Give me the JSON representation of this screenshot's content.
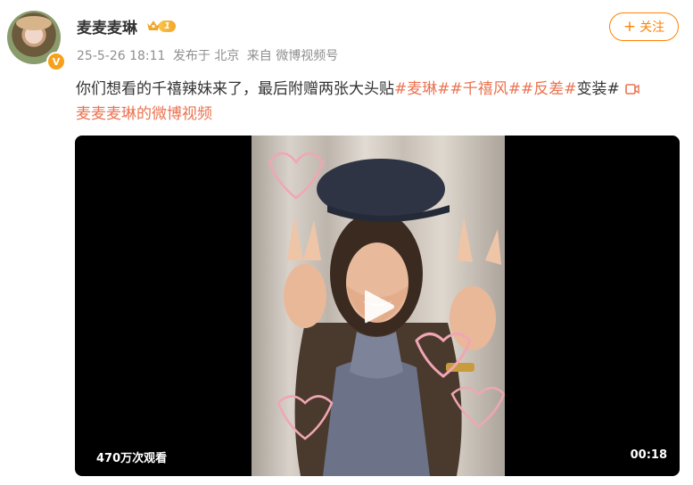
{
  "author": {
    "name": "麦麦麦琳",
    "level": "1",
    "verified_badge": "V"
  },
  "post": {
    "time": "25-5-26 18:11",
    "location": "发布于 北京",
    "source": "来自 微博视频号"
  },
  "follow_label": "关注",
  "caption": {
    "text": "你们想看的千禧辣妹来了，最后附赠两张大头贴",
    "tags": [
      "#麦琳#",
      "#千禧风#",
      "#反差#"
    ],
    "suffix": "变装#",
    "video_link": "麦麦麦琳的微博视频"
  },
  "video": {
    "views": "470万次观看",
    "duration": "00:18"
  },
  "colors": {
    "accent": "#ff8200",
    "tag": "#eb7350",
    "meta": "#8f8f8f"
  }
}
